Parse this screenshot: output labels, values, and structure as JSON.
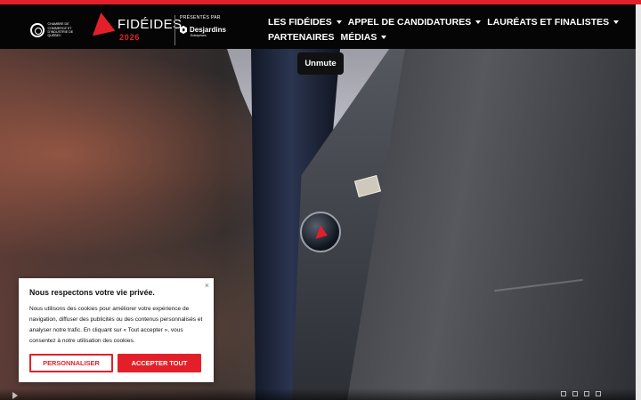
{
  "header": {
    "chamber_text": "Chambre de commerce et d'industrie de Québec",
    "brand_name": "FIDÉIDES",
    "brand_year": "2026",
    "presented_by": "PRÉSENTÉS PAR",
    "sponsor_name": "Desjardins",
    "sponsor_subtitle": "Entreprises",
    "nav": [
      {
        "label": "LES FIDÉIDES",
        "has_dropdown": true
      },
      {
        "label": "APPEL DE CANDIDATURES",
        "has_dropdown": true
      },
      {
        "label": "LAURÉATS ET FINALISTES",
        "has_dropdown": true
      },
      {
        "label": "PARTENAIRES",
        "has_dropdown": false
      },
      {
        "label": "MÉDIAS",
        "has_dropdown": true
      }
    ]
  },
  "hero": {
    "unmute_label": "Unmute",
    "pin_label": "FIDÉIDES"
  },
  "cookie_banner": {
    "title": "Nous respectons votre vie privée.",
    "text": "Nous utilisons des cookies pour améliorer votre expérience de navigation, diffuser des publicités ou des contenus personnalisés et analyser notre trafic. En cliquant sur « Tout accepter », vous consentez à notre utilisation des cookies.",
    "close_label": "×",
    "customize_label": "PERSONNALISER",
    "accept_label": "ACCEPTER TOUT"
  },
  "colors": {
    "brand_red": "#e3202a",
    "header_black": "#050505"
  },
  "icons": {
    "chamber_logo": "chamber-logo-icon",
    "dropdown": "chevron-down-icon",
    "close": "close-icon",
    "play": "play-icon"
  }
}
